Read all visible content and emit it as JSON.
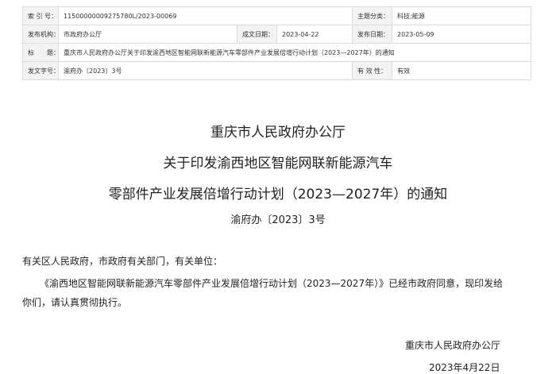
{
  "meta": {
    "index_no_label": "索 引 号：",
    "index_no": "11500000009275780L/2023-00069",
    "topic_label": "主题分类：",
    "topic": "科技;能源",
    "issuer_label": "发布机构：",
    "issuer": "市政府办公厅",
    "written_date_label": "成文日期：",
    "written_date": "2023-04-22",
    "publish_date_label": "发布日期：",
    "publish_date": "2023-05-09",
    "title_label": "标　　题：",
    "title": "重庆市人民政府办公厅关于印发渝西地区智能网联新能源汽车零部件产业发展倍增行动计划（2023—2027年）的通知",
    "doc_no_label": "发文字号：",
    "doc_no": "渝府办〔2023〕3号",
    "validity_label": "有 效 性：",
    "validity": "有效"
  },
  "heading": {
    "issuer": "重庆市人民政府办公厅",
    "line2": "关于印发渝西地区智能网联新能源汽车",
    "line3": "零部件产业发展倍增行动计划（2023—2027年）的通知",
    "doc_no": "渝府办〔2023〕3号"
  },
  "body": {
    "salutation": "有关区人民政府，市政府有关部门，有关单位：",
    "para1": "《渝西地区智能网联新能源汽车零部件产业发展倍增行动计划（2023—2027年）》已经市政府同意，现印发给",
    "para2": "你们，请认真贯彻执行。"
  },
  "signature": {
    "org": "重庆市人民政府办公厅",
    "date": "2023年4月22日"
  }
}
